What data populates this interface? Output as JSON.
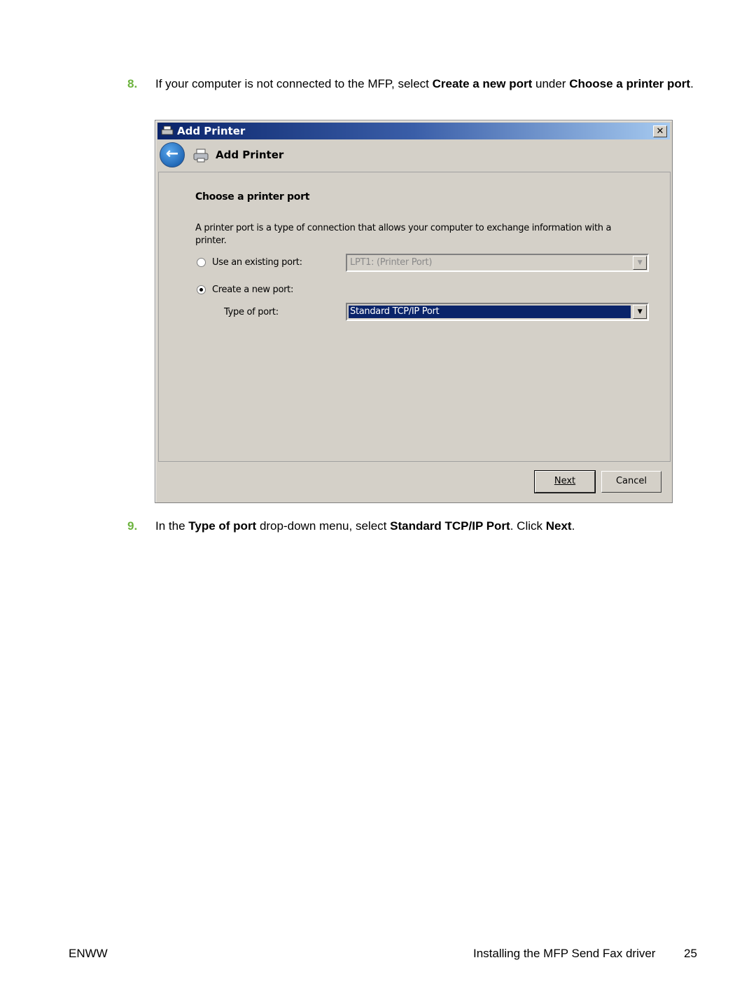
{
  "steps": [
    {
      "number": "8.",
      "parts": [
        "If your computer is not connected to the MFP, select ",
        "Create a new port",
        " under ",
        "Choose a printer port",
        "."
      ]
    },
    {
      "number": "9.",
      "parts": [
        "In the ",
        "Type of port",
        " drop-down menu, select ",
        "Standard TCP/IP Port",
        ". Click ",
        "Next",
        "."
      ]
    }
  ],
  "dialog": {
    "title": "Add Printer",
    "header": "Add Printer",
    "heading": "Choose a printer port",
    "description": "A printer port is a type of connection that allows your computer to exchange information with a printer.",
    "use_existing_label": "Use an existing port:",
    "existing_port_value": "LPT1: (Printer Port)",
    "create_new_label": "Create a new port:",
    "type_of_port_label": "Type of port:",
    "type_of_port_value": "Standard TCP/IP Port",
    "selected_option": "create_new",
    "next_label": "Next",
    "cancel_label": "Cancel",
    "close_glyph": "✕"
  },
  "footer": {
    "left": "ENWW",
    "right": "Installing the MFP Send Fax driver",
    "page": "25"
  },
  "colors": {
    "step_number": "#6cb33e",
    "selection": "#0a246a",
    "dialog_bg": "#d4d0c8"
  }
}
